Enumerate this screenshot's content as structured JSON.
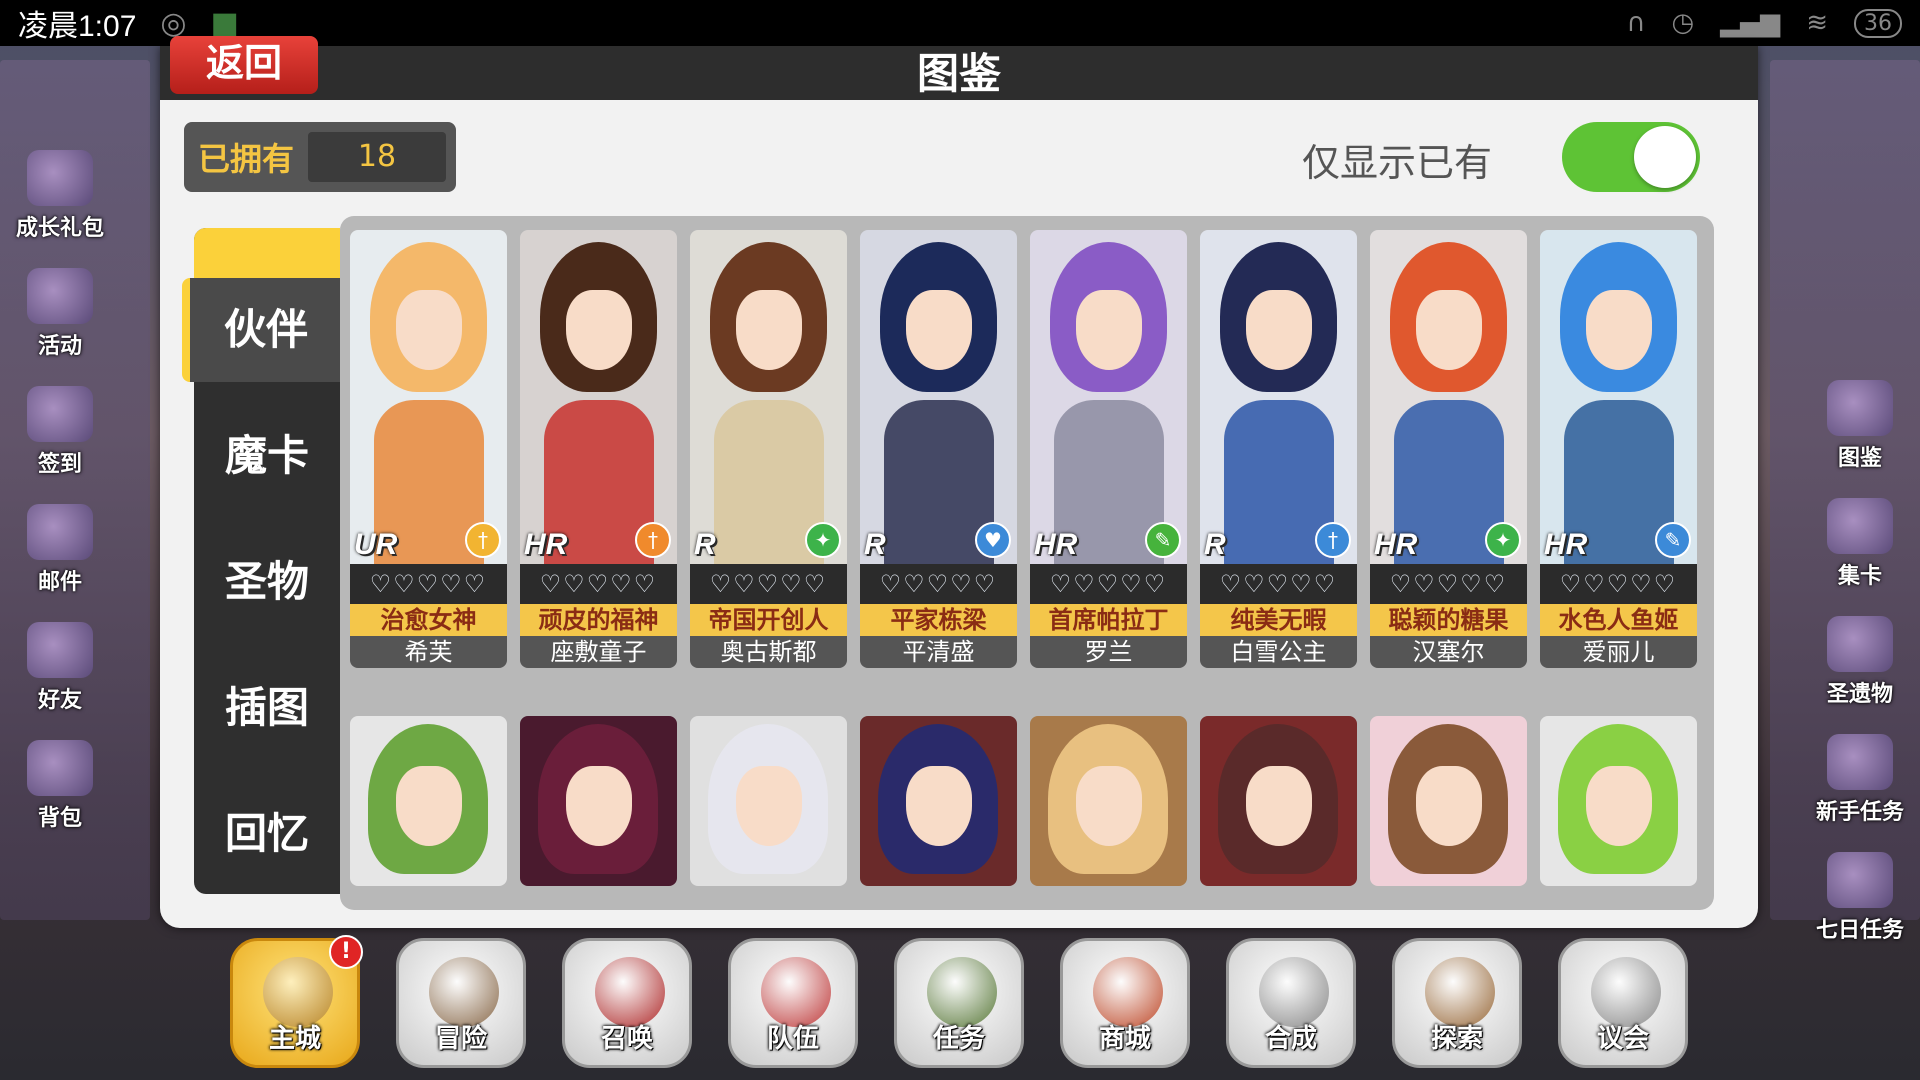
{
  "status_bar": {
    "time": "凌晨1:07",
    "battery": "36"
  },
  "left_menu": [
    "成长礼包",
    "活动",
    "签到",
    "邮件",
    "好友",
    "背包"
  ],
  "right_menu": [
    "图鉴",
    "集卡",
    "圣遗物",
    "新手任务",
    "七日任务"
  ],
  "panel": {
    "back_label": "返回",
    "title": "图鉴",
    "owned_label": "已拥有",
    "owned_count": "18",
    "filter_label": "仅显示已有",
    "filter_on": true
  },
  "tabs": [
    "伙伴",
    "魔卡",
    "圣物",
    "插图",
    "回忆"
  ],
  "active_tab": "伙伴",
  "cards": [
    {
      "rarity": "UR",
      "element": "†",
      "element_color": "#f2b431",
      "stars": "♡♡♡♡♡",
      "title": "治愈女神",
      "name": "希芙",
      "hair": "#f4b86a",
      "body": "#e8883a",
      "bg": "#e7ecef"
    },
    {
      "rarity": "HR",
      "element": "†",
      "element_color": "#f08a2c",
      "stars": "♡♡♡♡♡",
      "title": "顽皮的福神",
      "name": "座敷童子",
      "hair": "#4a2a1a",
      "body": "#c8322e",
      "bg": "#d7d2d0"
    },
    {
      "rarity": "R",
      "element": "✦",
      "element_color": "#3db34a",
      "stars": "♡♡♡♡♡",
      "title": "帝国开创人",
      "name": "奥古斯都",
      "hair": "#6b3a22",
      "body": "#d9c79c",
      "bg": "#dedcd6"
    },
    {
      "rarity": "R",
      "element": "♥",
      "element_color": "#3c8ad8",
      "stars": "♡♡♡♡♡",
      "title": "平家栋梁",
      "name": "平清盛",
      "hair": "#1c2a5a",
      "body": "#2c3050",
      "bg": "#d6d8e2"
    },
    {
      "rarity": "HR",
      "element": "✎",
      "element_color": "#46b33c",
      "stars": "♡♡♡♡♡",
      "title": "首席帕拉丁",
      "name": "罗兰",
      "hair": "#8a5cc6",
      "body": "#8c8ca0",
      "bg": "#dcd8e6"
    },
    {
      "rarity": "R",
      "element": "†",
      "element_color": "#3c8ad8",
      "stars": "♡♡♡♡♡",
      "title": "纯美无暇",
      "name": "白雪公主",
      "hair": "#232a55",
      "body": "#2d56a8",
      "bg": "#dfe3ec"
    },
    {
      "rarity": "HR",
      "element": "✦",
      "element_color": "#3db34a",
      "stars": "♡♡♡♡♡",
      "title": "聪颖的糖果",
      "name": "汉塞尔",
      "hair": "#e0582e",
      "body": "#2f5aa8",
      "bg": "#e2dede"
    },
    {
      "rarity": "HR",
      "element": "✎",
      "element_color": "#3c8ad8",
      "stars": "♡♡♡♡♡",
      "title": "水色人鱼姬",
      "name": "爱丽儿",
      "hair": "#3a8ae0",
      "body": "#2b5c98",
      "bg": "#d8e6ee"
    }
  ],
  "cards_row2": [
    {
      "hair": "#6ea844",
      "bg": "#e6e6e6"
    },
    {
      "hair": "#6a1e3a",
      "bg": "#4a1a2e"
    },
    {
      "hair": "#e6e6ee",
      "bg": "#e0e0e0"
    },
    {
      "hair": "#2a2a6a",
      "bg": "#6a2a2a"
    },
    {
      "hair": "#e8c080",
      "bg": "#a87a4a"
    },
    {
      "hair": "#5a2a2a",
      "bg": "#7a2a2a"
    },
    {
      "hair": "#8a5a3a",
      "bg": "#f0d0d8"
    },
    {
      "hair": "#8ad044",
      "bg": "#e6e6e6"
    }
  ],
  "bottom_nav": [
    {
      "label": "主城",
      "active": true,
      "badge": "!",
      "icon_color": "#b8862a"
    },
    {
      "label": "冒险",
      "active": false,
      "badge": "",
      "icon_color": "#8a6a4a"
    },
    {
      "label": "召唤",
      "active": false,
      "badge": "",
      "icon_color": "#b02a2a"
    },
    {
      "label": "队伍",
      "active": false,
      "badge": "",
      "icon_color": "#c03a3a"
    },
    {
      "label": "任务",
      "active": false,
      "badge": "",
      "icon_color": "#5a7a3a"
    },
    {
      "label": "商城",
      "active": false,
      "badge": "",
      "icon_color": "#c04a2a"
    },
    {
      "label": "合成",
      "active": false,
      "badge": "",
      "icon_color": "#8a8a8a"
    },
    {
      "label": "探索",
      "active": false,
      "badge": "",
      "icon_color": "#9a6a3a"
    },
    {
      "label": "议会",
      "active": false,
      "badge": "",
      "icon_color": "#8a8a8a"
    }
  ]
}
